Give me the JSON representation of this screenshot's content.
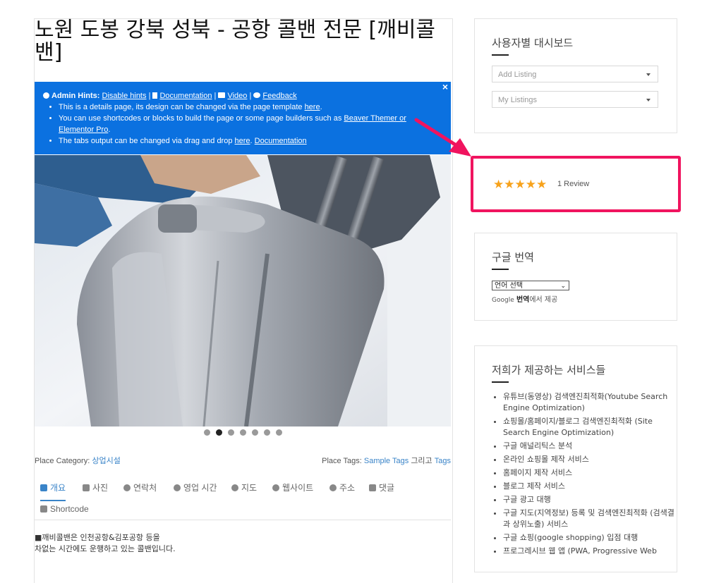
{
  "main": {
    "title": "노원 도봉 강북 성북 - 공항 콜밴 전문 [깨비콜밴]",
    "hints": {
      "label": "Admin Hints:",
      "disable": "Disable hints",
      "sep1": "|",
      "documentation": "Documentation",
      "sep2": "|",
      "video": "Video",
      "sep3": "|",
      "feedback": "Feedback",
      "close": "×",
      "items": [
        {
          "text": "This is a details page, its design can be changed via the page template ",
          "link": "here",
          "tail": "."
        },
        {
          "text": "You can use shortcodes or blocks to build the page or some page builders such as ",
          "link": "Beaver Themer or Elementor Pro",
          "tail": "."
        },
        {
          "text": "The tabs output can be changed via drag and drop ",
          "link": "here",
          "tail": ". ",
          "link2": "Documentation"
        }
      ]
    },
    "slider": {
      "dots": 7,
      "active": 1
    },
    "category_label": "Place Category:",
    "category_value": "상업시설",
    "tags_label": "Place Tags:",
    "tags_value1": "Sample Tags",
    "tags_and": "그리고",
    "tags_value2": "Tags",
    "tabs": [
      {
        "label": "개요",
        "icon": "home-icon"
      },
      {
        "label": "사진",
        "icon": "image-icon"
      },
      {
        "label": "연락처",
        "icon": "gear-icon"
      },
      {
        "label": "영업 시간",
        "icon": "clock-icon"
      },
      {
        "label": "지도",
        "icon": "globe-icon"
      },
      {
        "label": "웹사이트",
        "icon": "gear-icon"
      },
      {
        "label": "주소",
        "icon": "map-marker-icon"
      },
      {
        "label": "댓글",
        "icon": "comments-icon"
      },
      {
        "label": "Shortcode",
        "icon": "sitemap-icon"
      }
    ],
    "description": [
      "■깨비콜밴은 인천공항&김포공항 등을",
      "차없는 시간에도 운행하고 있는 콜밴입니다."
    ]
  },
  "sidebar": {
    "dashboard": {
      "title": "사용자별 대시보드",
      "add_listing": "Add Listing",
      "my_listings": "My Listings"
    },
    "review": {
      "stars": 5,
      "text": "1 Review",
      "star_color": "#f7a21b",
      "highlight_color": "#f0145f"
    },
    "translate": {
      "title": "구글 번역",
      "select": "언어 선택",
      "caret": "⌄",
      "google": "Google",
      "powered_bold": "번역",
      "powered_rest": "에서 제공"
    },
    "services": {
      "title": "저희가 제공하는 서비스들",
      "items": [
        "유튜브(동영상) 검색엔진최적화(Youtube Search Engine Optimization)",
        "쇼핑몰/홈페이지/블로그 검색엔진최적화 (Site Search Engine Optimization)",
        "구글 애널리틱스 분석",
        "온라인 쇼핑몰 제작 서비스",
        "홈페이지 제작 서비스",
        "블로그 제작 서비스",
        "구글 광고 대행",
        "구글 지도(지역정보) 등록 및 검색엔진최적화 (검색결과 상위노출) 서비스",
        "구글 쇼핑(google shopping) 입점 대행",
        "프로그레시브 웹 앱 (PWA, Progressive Web"
      ]
    }
  },
  "colors": {
    "hint_bg": "#0b71e0",
    "link": "#3a84c8",
    "arrow": "#f0145f"
  }
}
